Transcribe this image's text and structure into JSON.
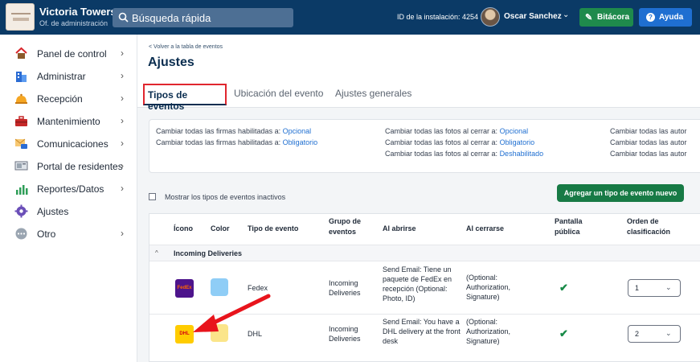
{
  "header": {
    "org_name": "Victoria Towers",
    "org_subtitle": "Of. de administración",
    "search_placeholder": "Búsqueda rápida",
    "installation_id": "ID de la instalación: 4254",
    "user_name": "Oscar Sanchez",
    "log_label": "Bitácora",
    "help_label": "Ayuda"
  },
  "sidebar": {
    "items": [
      {
        "label": "Panel de control",
        "icon": "home-icon",
        "chevron": "›"
      },
      {
        "label": "Administrar",
        "icon": "building-icon",
        "chevron": "›"
      },
      {
        "label": "Recepción",
        "icon": "reception-bell-icon",
        "chevron": "›"
      },
      {
        "label": "Mantenimiento",
        "icon": "toolbox-icon",
        "chevron": "›"
      },
      {
        "label": "Comunicaciones",
        "icon": "mail-icon",
        "chevron": "›"
      },
      {
        "label": "Portal de residentes",
        "icon": "portal-icon",
        "chevron": "›"
      },
      {
        "label": "Reportes/Datos",
        "icon": "bar-chart-icon",
        "chevron": "›"
      },
      {
        "label": "Ajustes",
        "icon": "gear-icon",
        "chevron": ""
      },
      {
        "label": "Otro",
        "icon": "more-icon",
        "chevron": "›"
      }
    ]
  },
  "main": {
    "back_link": "< Volver a la tabla de eventos",
    "title": "Ajustes",
    "tabs": [
      "Tipos de eventos",
      "Ubicación del evento",
      "Ajustes generales"
    ],
    "bulk": {
      "sig_prefix": "Cambiar todas las firmas habilitadas a: ",
      "sig_opt": "Opcional",
      "sig_req": "Obligatorio",
      "photo_prefix": "Cambiar todas las fotos al cerrar a: ",
      "photo_opt": "Opcional",
      "photo_req": "Obligatorio",
      "photo_dis": "Deshabilitado",
      "auth_text": "Cambiar todas las autor"
    },
    "inactive_label": "Mostrar los tipos de eventos inactivos",
    "add_button": "Agregar un tipo de evento nuevo",
    "table": {
      "headers": {
        "icon": "Ícono",
        "color": "Color",
        "event_type": "Tipo de evento",
        "group": "Grupo de eventos",
        "on_open": "Al abrirse",
        "on_close": "Al cerrarse",
        "public_screen": "Pantalla pública",
        "sort_order": "Orden de clasificación"
      },
      "group_name": "Incoming Deliveries",
      "rows": [
        {
          "brand_text": "FedEx",
          "brand_bg": "#4d148c",
          "swatch": "#8fcdf6",
          "name": "Fedex",
          "group": "Incoming Deliveries",
          "on_open": "Send Email: Tiene un paquete de FedEx en recepción (Optional: Photo, ID)",
          "on_close": "(Optional: Authorization, Signature)",
          "public": "✔",
          "order": "1"
        },
        {
          "brand_text": "DHL",
          "brand_bg": "#ffcc00",
          "swatch": "#fbe58a",
          "name": "DHL",
          "group": "Incoming Deliveries",
          "on_open": "Send Email: You have a DHL delivery at the front desk",
          "on_close": "(Optional: Authorization, Signature)",
          "public": "✔",
          "order": "2"
        }
      ]
    }
  },
  "colors": {
    "topbar": "#0b3a66",
    "accent_green": "#177a45",
    "accent_blue": "#1f6fd1",
    "highlight_red": "#e0262e"
  }
}
